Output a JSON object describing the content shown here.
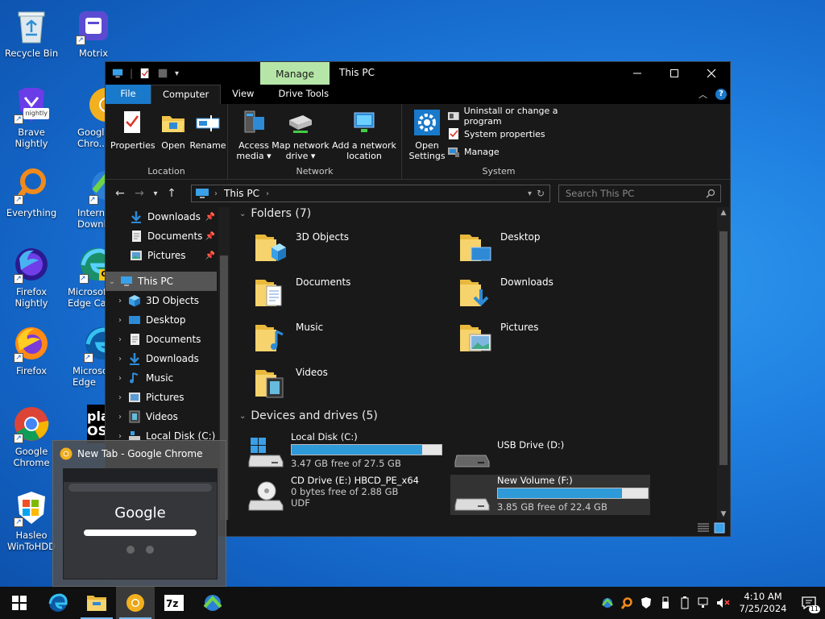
{
  "desktop": {
    "icons": [
      {
        "label": "Recycle Bin"
      },
      {
        "label": "Motrix"
      },
      {
        "label": "Brave Nightly"
      },
      {
        "label": "Google Chro..."
      },
      {
        "label": "Everything"
      },
      {
        "label": "Internet Downlo..."
      },
      {
        "label": "Firefox Nightly"
      },
      {
        "label": "Microsoft Edge Can..."
      },
      {
        "label": "Firefox"
      },
      {
        "label": "Microsoft Edge"
      },
      {
        "label": "Google Chrome"
      },
      {
        "label": "plat OS"
      },
      {
        "label": "Hasleo WinToHDD"
      }
    ],
    "badges": {
      "nightly": "nightly",
      "can": "CAN"
    }
  },
  "explorer": {
    "title": "This PC",
    "context_tab": "Manage",
    "tabs": [
      "File",
      "Computer",
      "View",
      "Drive Tools"
    ],
    "ribbon": {
      "location": {
        "label": "Location",
        "buttons": [
          "Properties",
          "Open",
          "Rename"
        ]
      },
      "network": {
        "label": "Network",
        "access_media": [
          "Access",
          "media ▾"
        ],
        "map_drive": [
          "Map network",
          "drive ▾"
        ],
        "add_location": [
          "Add a network",
          "location"
        ]
      },
      "system": {
        "label": "System",
        "open_settings": [
          "Open",
          "Settings"
        ],
        "uninstall": "Uninstall or change a program",
        "properties": "System properties",
        "manage": "Manage"
      }
    },
    "address": {
      "path": "This PC",
      "search_placeholder": "Search This PC"
    },
    "nav": {
      "quick": [
        {
          "label": "Downloads"
        },
        {
          "label": "Documents"
        },
        {
          "label": "Pictures"
        }
      ],
      "this_pc": "This PC",
      "children": [
        {
          "label": "3D Objects"
        },
        {
          "label": "Desktop"
        },
        {
          "label": "Documents"
        },
        {
          "label": "Downloads"
        },
        {
          "label": "Music"
        },
        {
          "label": "Pictures"
        },
        {
          "label": "Videos"
        },
        {
          "label": "Local Disk (C:)"
        }
      ]
    },
    "folders_header": "Folders (7)",
    "folders": [
      {
        "name": "3D Objects"
      },
      {
        "name": "Desktop"
      },
      {
        "name": "Documents"
      },
      {
        "name": "Downloads"
      },
      {
        "name": "Music"
      },
      {
        "name": "Pictures"
      },
      {
        "name": "Videos"
      }
    ],
    "devices_header": "Devices and drives (5)",
    "drives": [
      {
        "name": "Local Disk (C:)",
        "free": "3.47 GB free of 27.5 GB",
        "used_fraction": 0.87
      },
      {
        "name": "USB Drive (D:)"
      },
      {
        "name": "CD Drive (E:) HBCD_PE_x64",
        "free": "0 bytes free of 2.88 GB",
        "fs": "UDF"
      },
      {
        "name": "New Volume (F:)",
        "free": "3.85 GB free of 22.4 GB",
        "used_fraction": 0.83
      }
    ]
  },
  "preview": {
    "title": "New Tab - Google Chrome",
    "google": "Google"
  },
  "taskbar": {
    "time": "4:10 AM",
    "date": "7/25/2024",
    "notifications": "11"
  },
  "colors": {
    "accent": "#1979ca",
    "manage_tab": "#b5e6a7",
    "drive_bar": "#2f9ad8"
  }
}
